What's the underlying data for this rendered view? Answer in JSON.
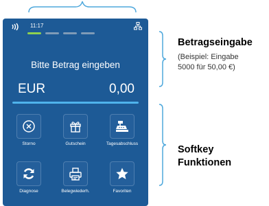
{
  "status": {
    "time": "11:17",
    "pips": 4,
    "active_pip": 1
  },
  "main": {
    "prompt": "Bitte Betrag eingeben",
    "currency": "EUR",
    "amount": "0,00"
  },
  "softkeys": [
    {
      "label": "Storno",
      "icon": "cancel-x-icon"
    },
    {
      "label": "Gutschein",
      "icon": "gift-icon"
    },
    {
      "label": "Tagesabschluss",
      "icon": "cash-register-icon"
    },
    {
      "label": "Diagnose",
      "icon": "refresh-icon"
    },
    {
      "label": "Belegwiederh.",
      "icon": "printer-icon"
    },
    {
      "label": "Favoriten",
      "icon": "star-icon"
    }
  ],
  "annotations": {
    "betrag_title": "Betragseingabe",
    "betrag_line1": "(Beispiel: Eingabe",
    "betrag_line2": "5000 für 50,00 €)",
    "softkey_line1": "Softkey",
    "softkey_line2": "Funktionen"
  },
  "colors": {
    "screen_bg": "#1d5a96",
    "accent_line": "#4fb3ec",
    "active_pip": "#8fd14f",
    "brace": "#4ea8dc"
  }
}
